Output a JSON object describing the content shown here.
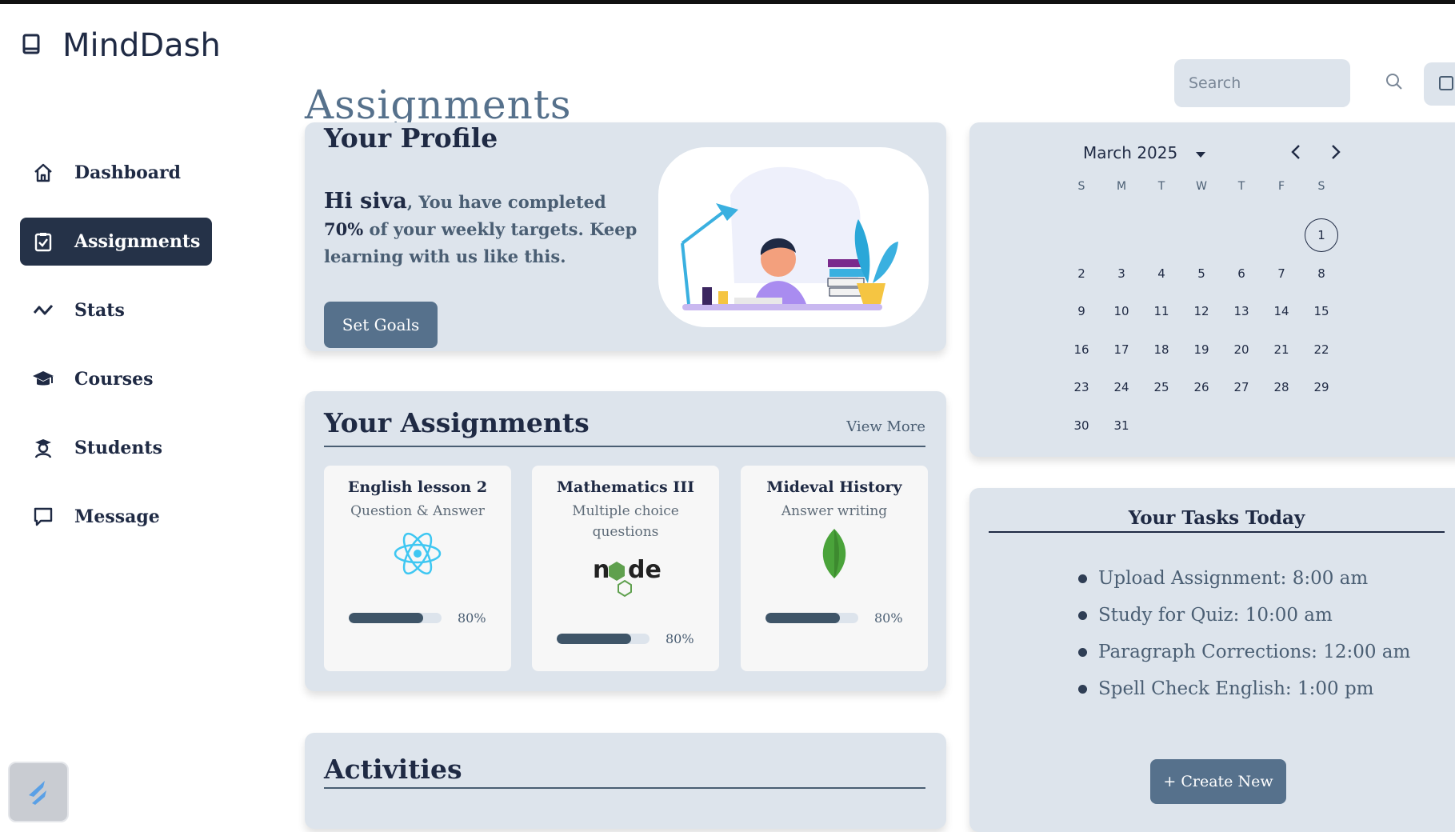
{
  "brand": {
    "name": "MindDash",
    "icon": "book-icon"
  },
  "sidebar": {
    "items": [
      {
        "label": "Dashboard",
        "icon": "home-icon"
      },
      {
        "label": "Assignments",
        "icon": "clipboard-check-icon",
        "active": true
      },
      {
        "label": "Stats",
        "icon": "trend-icon"
      },
      {
        "label": "Courses",
        "icon": "graduation-cap-icon"
      },
      {
        "label": "Students",
        "icon": "student-icon"
      },
      {
        "label": "Message",
        "icon": "chat-icon"
      }
    ]
  },
  "header": {
    "title": "Assignments",
    "search_placeholder": "Search"
  },
  "profile": {
    "title": "Your Profile",
    "greeting": "Hi siva",
    "message_a": ", You have completed ",
    "percent": "70%",
    "message_b": " of your weekly targets. Keep learning with us like this.",
    "button": "Set Goals"
  },
  "assignments": {
    "title": "Your Assignments",
    "view_more": "View More",
    "items": [
      {
        "title": "English lesson 2",
        "subtitle": "Question & Answer",
        "icon": "react-logo-icon",
        "progress": 0.8,
        "progress_label": "80%"
      },
      {
        "title": "Mathematics III",
        "subtitle": "Multiple choice questions",
        "icon": "node-logo-icon",
        "progress": 0.8,
        "progress_label": "80%"
      },
      {
        "title": "Mideval History",
        "subtitle": "Answer writing",
        "icon": "mongodb-leaf-icon",
        "progress": 0.8,
        "progress_label": "80%"
      }
    ]
  },
  "activities": {
    "title": "Activities"
  },
  "calendar": {
    "month_label": "March 2025",
    "weekdays": [
      "S",
      "M",
      "T",
      "W",
      "T",
      "F",
      "S"
    ],
    "selected_day": "1",
    "weeks": [
      [
        "",
        "",
        "",
        "",
        "",
        "",
        "1"
      ],
      [
        "2",
        "3",
        "4",
        "5",
        "6",
        "7",
        "8"
      ],
      [
        "9",
        "10",
        "11",
        "12",
        "13",
        "14",
        "15"
      ],
      [
        "16",
        "17",
        "18",
        "19",
        "20",
        "21",
        "22"
      ],
      [
        "23",
        "24",
        "25",
        "26",
        "27",
        "28",
        "29"
      ],
      [
        "30",
        "31",
        "",
        "",
        "",
        "",
        ""
      ]
    ]
  },
  "tasks": {
    "title": "Your Tasks Today",
    "items": [
      "Upload Assignment: 8:00 am",
      "Study for Quiz: 10:00 am",
      "Paragraph Corrections: 12:00 am",
      "Spell Check English: 1:00 pm"
    ],
    "button": "+ Create New"
  },
  "colors": {
    "accent": "#56718c",
    "active_nav": "#253248",
    "card_bg": "#dde4ec"
  }
}
